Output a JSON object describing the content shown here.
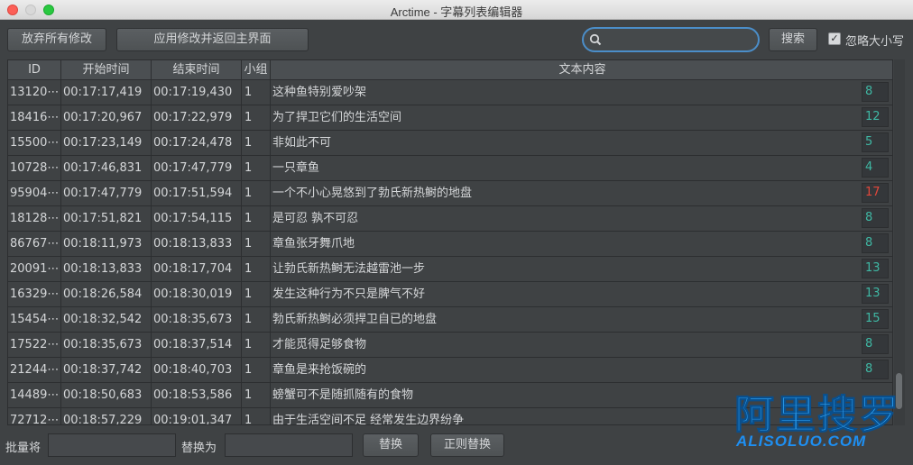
{
  "window": {
    "title": "Arctime - 字幕列表编辑器"
  },
  "toolbar": {
    "discard_label": "放弃所有修改",
    "apply_label": "应用修改并返回主界面",
    "search_value": "",
    "search_button_label": "搜索",
    "ignore_case_label": "忽略大小写",
    "ignore_case_checked": "✓"
  },
  "table": {
    "headers": {
      "id": "ID",
      "start": "开始时间",
      "end": "结束时间",
      "group": "小组",
      "text": "文本内容"
    },
    "rows": [
      {
        "id": "13120⋯",
        "start": "00:17:17,419",
        "end": "00:17:19,430",
        "group": "1",
        "text": "这种鱼特别爱吵架",
        "count": "8",
        "status": "ok"
      },
      {
        "id": "18416⋯",
        "start": "00:17:20,967",
        "end": "00:17:22,979",
        "group": "1",
        "text": "为了捍卫它们的生活空间",
        "count": "12",
        "status": "ok"
      },
      {
        "id": "15500⋯",
        "start": "00:17:23,149",
        "end": "00:17:24,478",
        "group": "1",
        "text": "非如此不可",
        "count": "5",
        "status": "ok"
      },
      {
        "id": "10728⋯",
        "start": "00:17:46,831",
        "end": "00:17:47,779",
        "group": "1",
        "text": "一只章鱼",
        "count": "4",
        "status": "ok"
      },
      {
        "id": "95904⋯",
        "start": "00:17:47,779",
        "end": "00:17:51,594",
        "group": "1",
        "text": "一个不小心晃悠到了勃氏新热鲥的地盘",
        "count": "17",
        "status": "warn"
      },
      {
        "id": "18128⋯",
        "start": "00:17:51,821",
        "end": "00:17:54,115",
        "group": "1",
        "text": "是可忍 孰不可忍",
        "count": "8",
        "status": "ok"
      },
      {
        "id": "86767⋯",
        "start": "00:18:11,973",
        "end": "00:18:13,833",
        "group": "1",
        "text": "章鱼张牙舞爪地",
        "count": "8",
        "status": "ok"
      },
      {
        "id": "20091⋯",
        "start": "00:18:13,833",
        "end": "00:18:17,704",
        "group": "1",
        "text": "让勃氏新热鲥无法越雷池一步",
        "count": "13",
        "status": "ok"
      },
      {
        "id": "16329⋯",
        "start": "00:18:26,584",
        "end": "00:18:30,019",
        "group": "1",
        "text": "发生这种行为不只是脾气不好",
        "count": "13",
        "status": "ok"
      },
      {
        "id": "15454⋯",
        "start": "00:18:32,542",
        "end": "00:18:35,673",
        "group": "1",
        "text": "勃氏新热鲥必须捍卫自已的地盘",
        "count": "15",
        "status": "ok"
      },
      {
        "id": "17522⋯",
        "start": "00:18:35,673",
        "end": "00:18:37,514",
        "group": "1",
        "text": "才能觅得足够食物",
        "count": "8",
        "status": "ok"
      },
      {
        "id": "21244⋯",
        "start": "00:18:37,742",
        "end": "00:18:40,703",
        "group": "1",
        "text": "章鱼是来抢饭碗的",
        "count": "8",
        "status": "ok"
      },
      {
        "id": "14489⋯",
        "start": "00:18:50,683",
        "end": "00:18:53,586",
        "group": "1",
        "text": "螃蟹可不是随抓随有的食物",
        "count": "",
        "status": "ok"
      },
      {
        "id": "72712⋯",
        "start": "00:18:57,229",
        "end": "00:19:01,347",
        "group": "1",
        "text": "由于生活空间不足 经常发生边界纷争",
        "count": "",
        "status": "ok"
      }
    ]
  },
  "bottom": {
    "batch_label": "批量将",
    "batch_value": "",
    "replace_with_label": "替换为",
    "replace_with_value": "",
    "replace_button": "替换",
    "regex_replace_button": "正则替换"
  },
  "watermark": {
    "main": "阿里搜罗",
    "sub": "ALISOLUO.COM"
  },
  "colors": {
    "ok_count": "#3fb8a4",
    "warn_count": "#e2473b",
    "accent": "#4b8ec9"
  }
}
